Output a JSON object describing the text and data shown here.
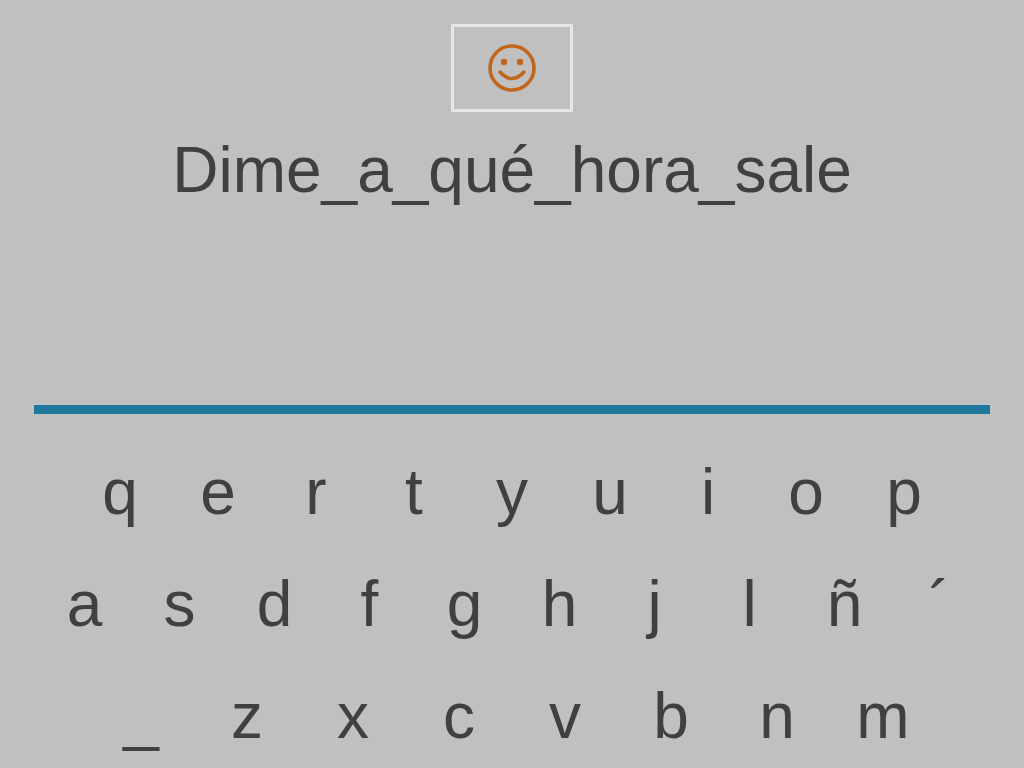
{
  "prompt": "Dime_a_qué_hora_sale",
  "keyboard": {
    "rows": [
      [
        "q",
        "e",
        "r",
        "t",
        "y",
        "u",
        "i",
        "o",
        "p"
      ],
      [
        "a",
        "s",
        "d",
        "f",
        "g",
        "h",
        "j",
        "l",
        "ñ",
        "´"
      ],
      [
        "_",
        "z",
        "x",
        "c",
        "v",
        "b",
        "n",
        "m"
      ]
    ]
  }
}
